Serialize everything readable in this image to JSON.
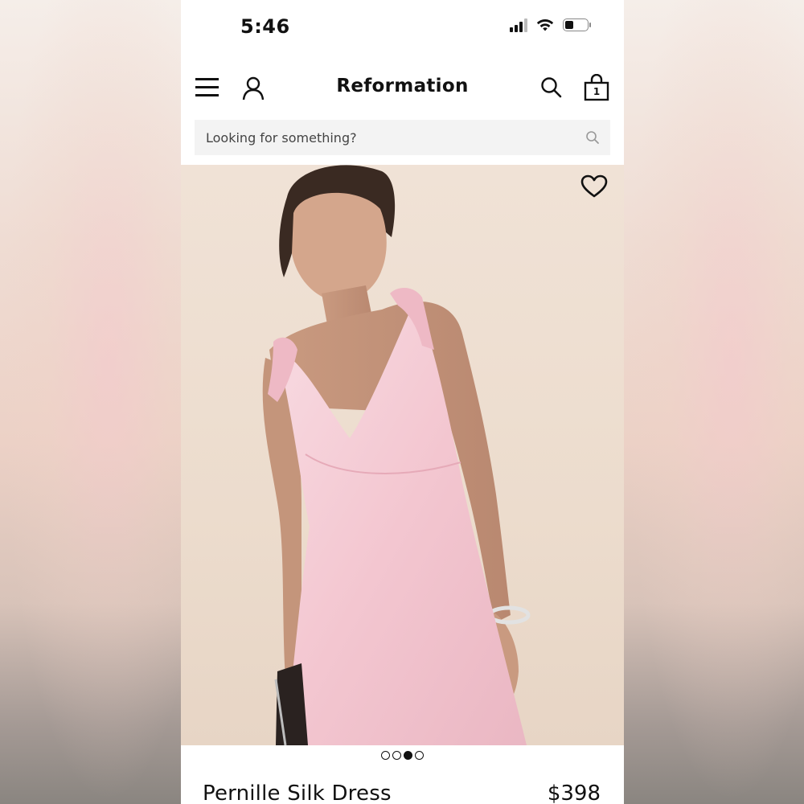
{
  "status_bar": {
    "time": "5:46",
    "signal_icon": "cellular-signal-icon",
    "wifi_icon": "wifi-icon",
    "battery_icon": "battery-icon"
  },
  "header": {
    "brand": "Reformation",
    "menu_icon": "hamburger-menu-icon",
    "account_icon": "user-icon",
    "search_icon": "search-icon",
    "bag_icon": "shopping-bag-icon",
    "bag_count": "1"
  },
  "search": {
    "placeholder": "Looking for something?",
    "icon": "search-icon"
  },
  "product": {
    "image_description_icon": "product-photo",
    "favorite_icon": "heart-icon",
    "carousel": {
      "count": 4,
      "active_index": 2
    },
    "name": "Pernille Silk Dress",
    "price": "$398"
  },
  "colors": {
    "text": "#111111",
    "search_bg": "#f3f3f3",
    "dress_pink": "#f3c9d2",
    "backdrop": "#efe0d4"
  }
}
